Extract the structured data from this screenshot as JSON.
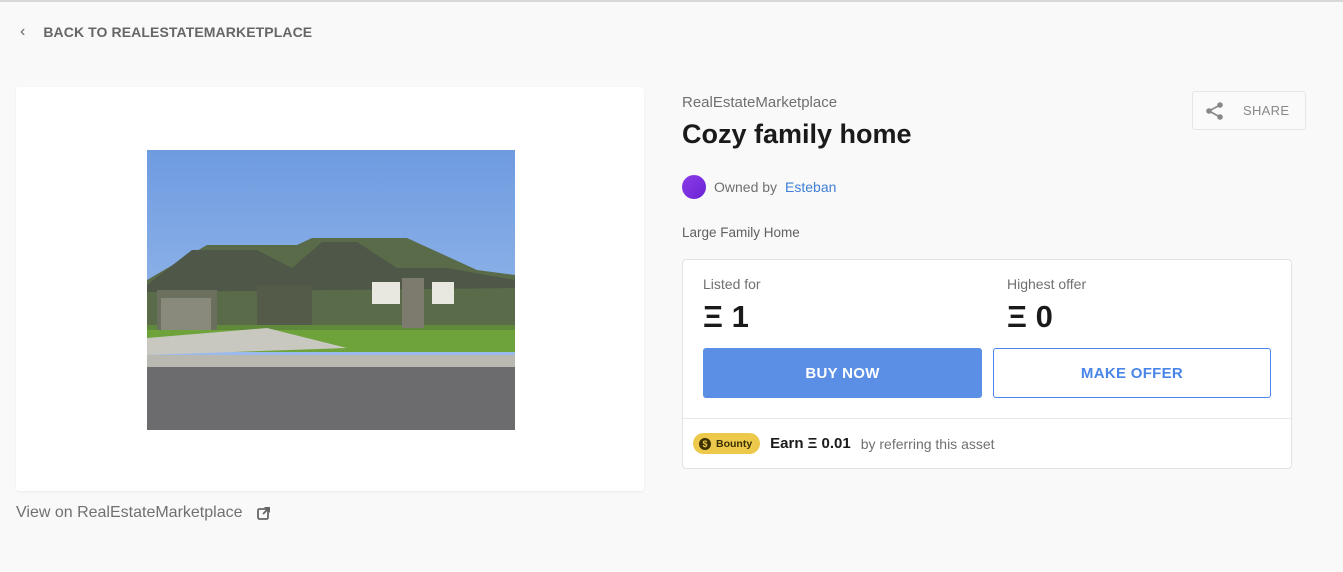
{
  "back_link": {
    "label": "BACK TO REALESTATEMARKETPLACE",
    "icon": "chevron-left-icon"
  },
  "asset": {
    "collection": "RealEstateMarketplace",
    "title": "Cozy family home",
    "owned_by_label": "Owned by",
    "owner_name": "Esteban",
    "description": "Large Family Home",
    "view_link": "View on RealEstateMarketplace"
  },
  "share": {
    "label": "SHARE",
    "icon": "share-icon"
  },
  "pricing": {
    "listed_label": "Listed for",
    "listed_value": "Ξ 1",
    "offer_label": "Highest offer",
    "offer_value": "Ξ 0",
    "buy_label": "BUY NOW",
    "offer_button_label": "MAKE OFFER"
  },
  "bounty": {
    "badge": "Bounty",
    "coin_symbol": "$",
    "earn": "Earn Ξ 0.01",
    "note": "by referring this asset"
  },
  "colors": {
    "accent": "#5b8fe6",
    "link": "#3f7fd6",
    "bounty": "#ecc94b",
    "avatar": "#7b2fe0"
  }
}
